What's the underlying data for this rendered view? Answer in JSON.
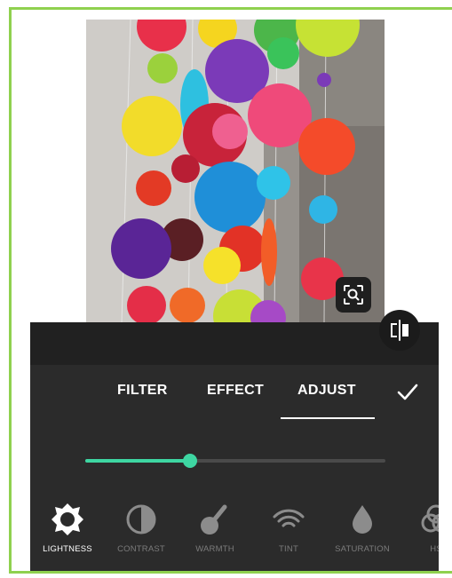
{
  "tabs": [
    {
      "label": "FILTER",
      "selected": false
    },
    {
      "label": "EFFECT",
      "selected": false
    },
    {
      "label": "ADJUST",
      "selected": true
    }
  ],
  "tools": [
    {
      "label": "LIGHTNESS",
      "icon": "lightness-icon",
      "active": true
    },
    {
      "label": "CONTRAST",
      "icon": "contrast-icon",
      "active": false
    },
    {
      "label": "WARMTH",
      "icon": "warmth-icon",
      "active": false
    },
    {
      "label": "TINT",
      "icon": "tint-icon",
      "active": false
    },
    {
      "label": "SATURATION",
      "icon": "saturation-icon",
      "active": false
    },
    {
      "label": "HS",
      "icon": "hsl-icon",
      "active": false
    }
  ],
  "slider": {
    "value": 0.35
  },
  "colors": {
    "accent": "#3ed6a2",
    "panel": "#2b2b2b",
    "frame": "#8fd14f"
  },
  "icons": {
    "zoom": "zoom-icon",
    "compare": "compare-icon",
    "confirm": "check-icon"
  }
}
